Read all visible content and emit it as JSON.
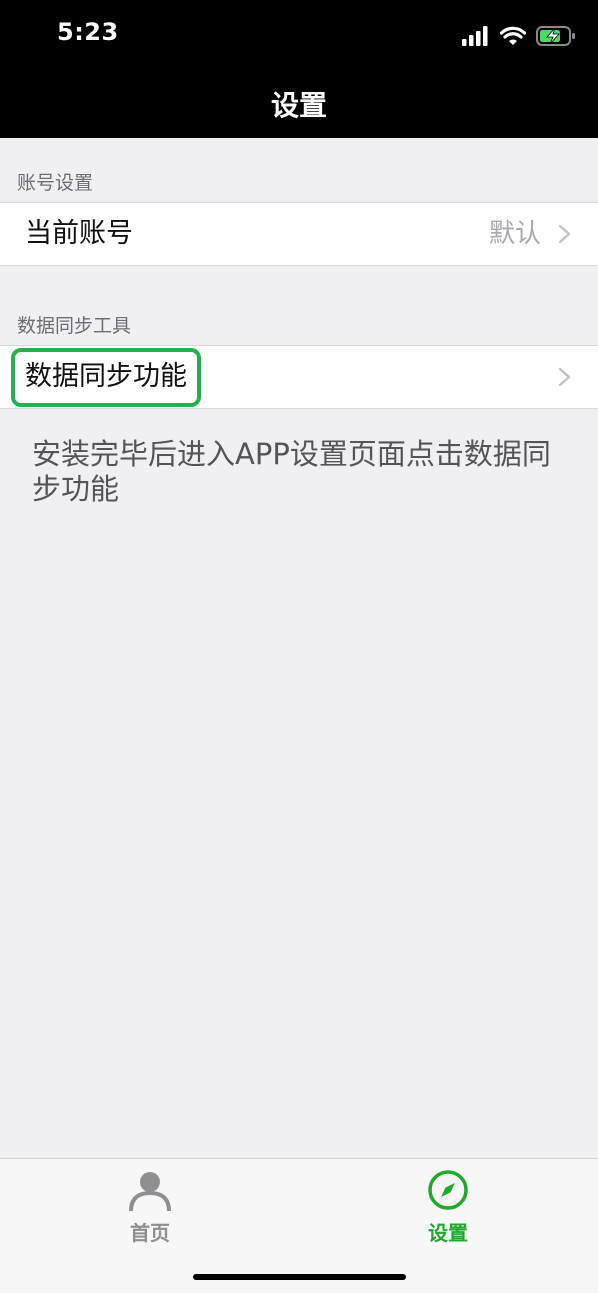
{
  "status_bar": {
    "time": "5:23"
  },
  "nav": {
    "title": "设置"
  },
  "sections": [
    {
      "label": "账号设置",
      "rows": [
        {
          "label": "当前账号",
          "value": "默认"
        }
      ]
    },
    {
      "label": "数据同步工具",
      "rows": [
        {
          "label": "数据同步功能"
        }
      ]
    }
  ],
  "hint_text": "安装完毕后进入APP设置页面点击数据同步功能",
  "tabbar": {
    "tabs": [
      {
        "label": "首页",
        "icon": "person-icon",
        "active": false
      },
      {
        "label": "设置",
        "icon": "compass-icon",
        "active": true
      }
    ],
    "active_color": "#22a82e",
    "inactive_color": "#8e8e93"
  },
  "colors": {
    "highlight": "#22b14c"
  }
}
